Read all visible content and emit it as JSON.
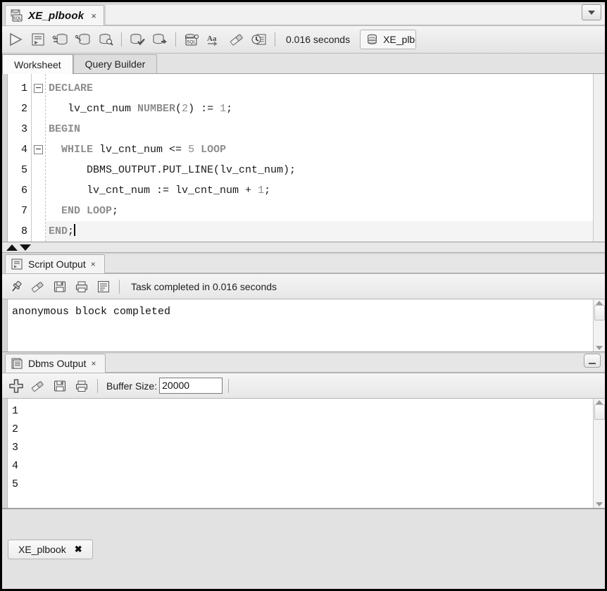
{
  "window": {
    "document_tab": {
      "title": "XE_plbook",
      "icon": "sql-worksheet-icon",
      "close_label": "×"
    },
    "tabstrip_menu_icon": "chevron-down-icon"
  },
  "toolbar": {
    "buttons": [
      {
        "name": "run-statement-button",
        "icon": "run-triangle-icon"
      },
      {
        "name": "run-script-button",
        "icon": "script-icon"
      },
      {
        "name": "commit-button",
        "icon": "commit-db-icon"
      },
      {
        "name": "rollback-button",
        "icon": "rollback-db-icon"
      },
      {
        "name": "unshared-sql-worksheet-button",
        "icon": "db-search-icon"
      },
      {
        "name": "autotrace-button",
        "icon": "db-check-icon"
      },
      {
        "name": "explain-plan-button",
        "icon": "db-export-icon"
      },
      {
        "name": "sql-history-button",
        "icon": "sql-star-icon"
      },
      {
        "name": "format-sql-button",
        "icon": "aa-icon"
      },
      {
        "name": "clear-button",
        "icon": "eraser-icon"
      },
      {
        "name": "query-history-button",
        "icon": "clock-doc-icon"
      }
    ],
    "timing": "0.016 seconds",
    "connection": {
      "name": "XE_plbook",
      "visible_text": "XE_plbo",
      "icon": "database-icon"
    }
  },
  "worksheet": {
    "tabs": [
      {
        "label": "Worksheet",
        "active": true
      },
      {
        "label": "Query Builder",
        "active": false
      }
    ],
    "code_lines": [
      {
        "number": "1",
        "fold": true,
        "current": false,
        "tokens": [
          {
            "t": "DECLARE",
            "k": true
          }
        ]
      },
      {
        "number": "2",
        "fold": false,
        "current": false,
        "tokens": [
          {
            "t": "   lv_cnt_num ",
            "k": false
          },
          {
            "t": "NUMBER",
            "k": true
          },
          {
            "t": "(",
            "k": false
          },
          {
            "t": "2",
            "k": false,
            "n": true
          },
          {
            "t": ") := ",
            "k": false
          },
          {
            "t": "1",
            "k": false,
            "n": true
          },
          {
            "t": ";",
            "k": false
          }
        ]
      },
      {
        "number": "3",
        "fold": false,
        "current": false,
        "tokens": [
          {
            "t": "BEGIN",
            "k": true
          }
        ]
      },
      {
        "number": "4",
        "fold": true,
        "current": false,
        "tokens": [
          {
            "t": "  ",
            "k": false
          },
          {
            "t": "WHILE",
            "k": true
          },
          {
            "t": " lv_cnt_num <= ",
            "k": false
          },
          {
            "t": "5",
            "k": false,
            "n": true
          },
          {
            "t": " ",
            "k": false
          },
          {
            "t": "LOOP",
            "k": true
          }
        ]
      },
      {
        "number": "5",
        "fold": false,
        "current": false,
        "tokens": [
          {
            "t": "      DBMS_OUTPUT.PUT_LINE(lv_cnt_num);",
            "k": false
          }
        ]
      },
      {
        "number": "6",
        "fold": false,
        "current": false,
        "tokens": [
          {
            "t": "      lv_cnt_num := lv_cnt_num + ",
            "k": false
          },
          {
            "t": "1",
            "k": false,
            "n": true
          },
          {
            "t": ";",
            "k": false
          }
        ]
      },
      {
        "number": "7",
        "fold": false,
        "current": false,
        "tokens": [
          {
            "t": "  ",
            "k": false
          },
          {
            "t": "END LOOP",
            "k": true
          },
          {
            "t": ";",
            "k": false
          }
        ]
      },
      {
        "number": "8",
        "fold": false,
        "current": true,
        "tokens": [
          {
            "t": "END",
            "k": true
          },
          {
            "t": ";",
            "k": false
          }
        ]
      }
    ]
  },
  "script_output": {
    "tab": {
      "label": "Script Output",
      "icon": "script-output-icon",
      "close_label": "×"
    },
    "buttons": [
      {
        "name": "pin-button",
        "icon": "pin-icon"
      },
      {
        "name": "clear-button",
        "icon": "eraser-icon"
      },
      {
        "name": "save-button",
        "icon": "save-disk-icon"
      },
      {
        "name": "print-button",
        "icon": "printer-icon"
      },
      {
        "name": "wrap-button",
        "icon": "lines-icon"
      }
    ],
    "status": "Task completed in 0.016 seconds",
    "lines": [
      "anonymous block completed"
    ]
  },
  "dbms_output": {
    "tab": {
      "label": "Dbms Output",
      "icon": "dbms-output-icon",
      "close_label": "×"
    },
    "buttons": [
      {
        "name": "add-connection-button",
        "icon": "plus-icon"
      },
      {
        "name": "clear-button",
        "icon": "eraser-icon"
      },
      {
        "name": "save-button",
        "icon": "save-disk-icon"
      },
      {
        "name": "print-button",
        "icon": "printer-icon"
      }
    ],
    "buffer_size_label": "Buffer Size:",
    "buffer_size_value": "20000",
    "minimize_label": "–",
    "lines": [
      "1",
      "2",
      "3",
      "4",
      "5"
    ]
  },
  "status_bar": {
    "tab_label": "XE_plbook",
    "close_label": "✖"
  },
  "colors": {
    "keyword": "#8d8d8d",
    "text": "#111111",
    "panel_bg": "#ebebeb",
    "editor_bg": "#ffffff"
  }
}
